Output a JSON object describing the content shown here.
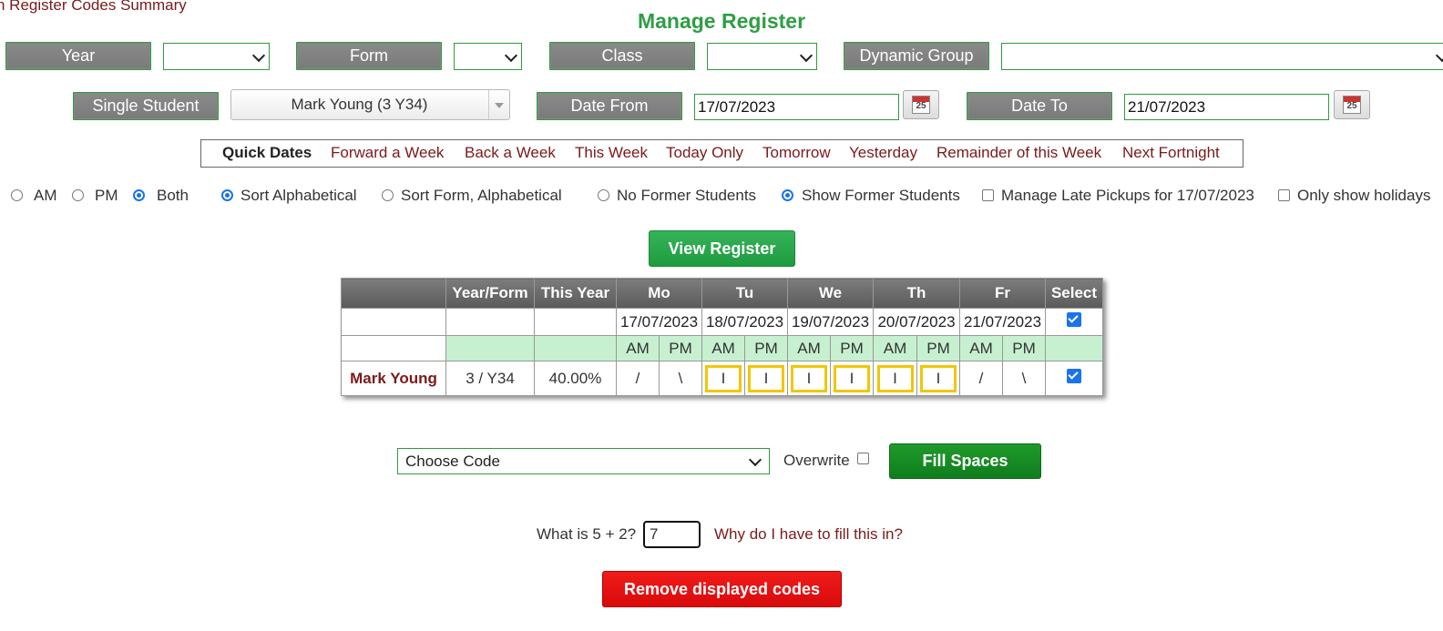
{
  "top_link": "n Register Codes Summary",
  "title": "Manage Register",
  "filters": {
    "year_label": "Year",
    "form_label": "Form",
    "class_label": "Class",
    "dynamic_label": "Dynamic Group",
    "single_student_label": "Single Student",
    "single_student_value": "Mark Young (3 Y34)",
    "date_from_label": "Date From",
    "date_from_value": "17/07/2023",
    "date_to_label": "Date To",
    "date_to_value": "21/07/2023",
    "calendar_icon_text": "25"
  },
  "quick_dates": {
    "heading": "Quick Dates",
    "items": [
      "Forward a Week",
      "Back a Week",
      "This Week",
      "Today Only",
      "Tomorrow",
      "Yesterday",
      "Remainder of this Week",
      "Next Fortnight"
    ]
  },
  "options": {
    "am": "AM",
    "pm": "PM",
    "both": "Both",
    "sort_alpha": "Sort Alphabetical",
    "sort_form_alpha": "Sort Form, Alphabetical",
    "no_former": "No Former Students",
    "show_former": "Show Former Students",
    "late_pickups": "Manage Late Pickups for 17/07/2023",
    "only_holidays": "Only show holidays"
  },
  "view_button": "View Register",
  "table": {
    "headers": [
      "",
      "Year/Form",
      "This Year",
      "Mo",
      "Tu",
      "We",
      "Th",
      "Fr",
      "Select"
    ],
    "dates": [
      "17/07/2023",
      "18/07/2023",
      "19/07/2023",
      "20/07/2023",
      "21/07/2023"
    ],
    "ampm": [
      "AM",
      "PM",
      "AM",
      "PM",
      "AM",
      "PM",
      "AM",
      "PM",
      "AM",
      "PM"
    ],
    "row": {
      "name": "Mark Young",
      "year_form": "3 / Y34",
      "this_year": "40.00%",
      "marks": [
        "/",
        "\\",
        "I",
        "I",
        "I",
        "I",
        "I",
        "I",
        "/",
        "\\"
      ]
    }
  },
  "code_select": "Choose Code",
  "overwrite_label": "Overwrite",
  "fill_button": "Fill Spaces",
  "captcha": {
    "question": "What is 5 + 2?",
    "answer": "7",
    "help_link": "Why do I have to fill this in?"
  },
  "remove_button": "Remove displayed codes",
  "colors": {
    "title_green": "#2f9e44",
    "link_maroon": "#7b1a1a",
    "highlight_yellow": "#f2c600",
    "ampm_bg": "#c6f0cf",
    "remove_red": "#e60f0f"
  }
}
